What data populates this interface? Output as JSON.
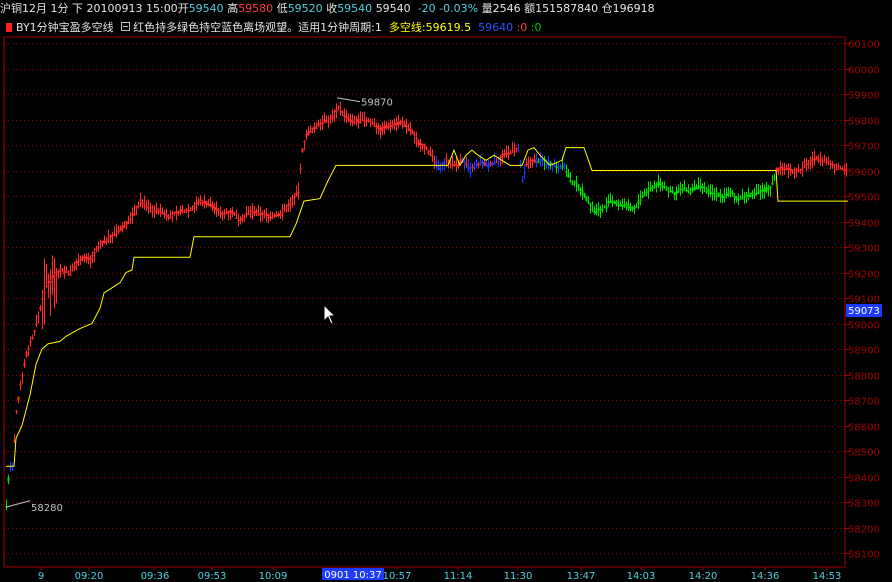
{
  "quote": {
    "symbol": "沪铜12月",
    "period": "1分",
    "direction": "下",
    "datetime": "20100913 15:00",
    "open_label": "开",
    "open": "59540",
    "high_label": "高",
    "high": "59580",
    "low_label": "低",
    "low": "59520",
    "close_label": "收",
    "close": "59540",
    "last": "59540",
    "change": "-20",
    "change_pct": "-0.03%",
    "volume_label": "量",
    "volume": "2546",
    "amount_label": "额",
    "amount": "151587840",
    "oi_label": "仓",
    "oi": "196918"
  },
  "indicator": {
    "name": "BY1分钟宝盈多空线",
    "desc": "红色持多绿色持空蓝色离场观望。适用1分钟周期:1",
    "line_label": "多空线:59619.5",
    "v2": "59640",
    "v3": ":0",
    "v4": ":0"
  },
  "chart_data": {
    "type": "candlestick",
    "ylim": [
      58050,
      60150
    ],
    "y_ticks": [
      60100,
      60000,
      59900,
      59800,
      59700,
      59600,
      59500,
      59400,
      59300,
      59200,
      59100,
      59000,
      58900,
      58800,
      58700,
      58600,
      58500,
      58400,
      58300,
      58200,
      58100
    ],
    "x_ticks": [
      "9",
      "09:20",
      "09:36",
      "09:53",
      "10:09",
      "10:57",
      "11:14",
      "11:30",
      "13:47",
      "14:03",
      "14:20",
      "14:36",
      "14:53"
    ],
    "cursor_x_label": "0901 10:37",
    "cursor_y_label": "59073",
    "annotations": [
      {
        "text": "58280",
        "value": 58280
      },
      {
        "text": "59870",
        "value": 59870
      }
    ],
    "colors": {
      "up": "#ff2a2a",
      "down": "#00e000",
      "exit": "#1a3aff",
      "line": "#ffff00",
      "grid": "#a00000"
    }
  }
}
